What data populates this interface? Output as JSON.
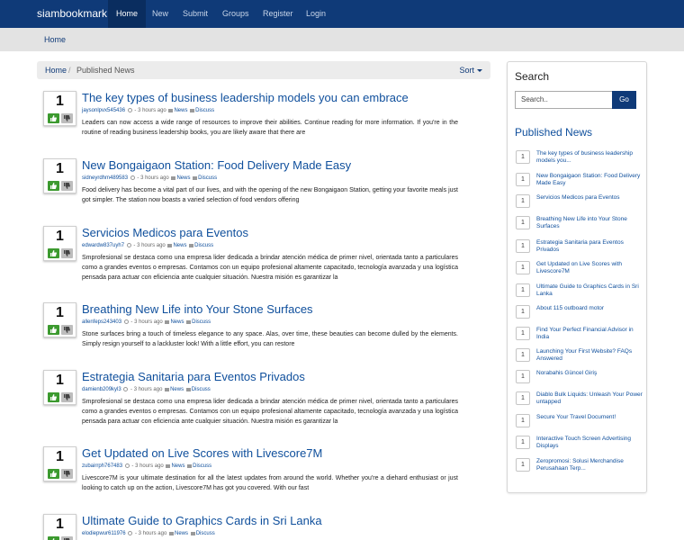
{
  "nav": {
    "brand": "siambookmark",
    "items": [
      "Home",
      "New",
      "Submit",
      "Groups",
      "Register",
      "Login"
    ]
  },
  "subbar": {
    "crumb": "Home"
  },
  "breadcrumb": {
    "home": "Home",
    "separator": "/",
    "current": "Published News",
    "sort": "Sort"
  },
  "posts": [
    {
      "votes": "1",
      "title": "The key types of business leadership models you can embrace",
      "user": "jaysonlpvx545436",
      "time": "3 hours ago",
      "category": "News",
      "discuss": "Discuss",
      "desc": "Leaders can now access a wide range of resources to improve their abilities. Continue reading for more information. If you're in the routine of reading business leadership books, you are likely aware that there are"
    },
    {
      "votes": "1",
      "title": "New Bongaigaon Station: Food Delivery Made Easy",
      "user": "sidneyrdhm489583",
      "time": "3 hours ago",
      "category": "News",
      "discuss": "Discuss",
      "desc": "Food delivery has become a vital part of our lives, and with the opening of the new Bongaigaon Station, getting your favorite meals just got simpler. The station now boasts a varied selection of food vendors offering"
    },
    {
      "votes": "1",
      "title": "Servicios Medicos para Eventos",
      "user": "edwardw837uyh7",
      "time": "3 hours ago",
      "category": "News",
      "discuss": "Discuss",
      "desc": "Smprofesional se destaca como una empresa lider dedicada a brindar atención médica de primer nivel, orientada tanto a particulares como a grandes eventos o empresas. Contamos con un equipo profesional altamente capacitado, tecnología avanzada y una logística pensada para actuar con eficiencia ante cualquier situación. Nuestra misión es garantizar la"
    },
    {
      "votes": "1",
      "title": "Breathing New Life into Your Stone Surfaces",
      "user": "allenfeps243403",
      "time": "3 hours ago",
      "category": "News",
      "discuss": "Discuss",
      "desc": "Stone surfaces bring a touch of timeless elegance to any space. Alas, over time, these beauties can become dulled by the elements. Simply resign yourself to a lackluster look! With a little effort, you can restore"
    },
    {
      "votes": "1",
      "title": "Estrategia Sanitaria para Eventos Privados",
      "user": "damienb209kyl3",
      "time": "3 hours ago",
      "category": "News",
      "discuss": "Discuss",
      "desc": "Smprofesional se destaca como una empresa lider dedicada a brindar atención médica de primer nivel, orientada tanto a particulares como a grandes eventos o empresas. Contamos con un equipo profesional altamente capacitado, tecnología avanzada y una logística pensada para actuar con eficiencia ante cualquier situación. Nuestra misión es garantizar la"
    },
    {
      "votes": "1",
      "title": "Get Updated on Live Scores with Livescore7M",
      "user": "zubairrph767483",
      "time": "3 hours ago",
      "category": "News",
      "discuss": "Discuss",
      "desc": "Livescore7M is your ultimate destination for all the latest updates from around the world. Whether you're a diehard enthusiast or just looking to catch up on the action, Livescore7M has got you covered. With our fast"
    },
    {
      "votes": "1",
      "title": "Ultimate Guide to Graphics Cards in Sri Lanka",
      "user": "elodiepwur611976",
      "time": "3 hours ago",
      "category": "News",
      "discuss": "Discuss",
      "desc": ""
    }
  ],
  "sidebar": {
    "search_title": "Search",
    "search_placeholder": "Search..",
    "go": "Go",
    "published_title": "Published News",
    "items": [
      {
        "count": "1",
        "label": "The key types of business leadership models you..."
      },
      {
        "count": "1",
        "label": "New Bongaigaon Station: Food Delivery Made Easy"
      },
      {
        "count": "1",
        "label": "Servicios Medicos para Eventos"
      },
      {
        "count": "1",
        "label": "Breathing New Life into Your Stone Surfaces"
      },
      {
        "count": "1",
        "label": "Estrategia Sanitaria para Eventos Privados"
      },
      {
        "count": "1",
        "label": "Get Updated on Live Scores with Livescore7M"
      },
      {
        "count": "1",
        "label": "Ultimate Guide to Graphics Cards in Sri Lanka"
      },
      {
        "count": "1",
        "label": "About 115 outboard motor"
      },
      {
        "count": "1",
        "label": "Find Your Perfect Financial Advisor in India"
      },
      {
        "count": "1",
        "label": "Launching Your First Website? FAQs Answered"
      },
      {
        "count": "1",
        "label": "Norabahis Güncel Giriş"
      },
      {
        "count": "1",
        "label": "Diablo Bulk Liquids: Unleash Your Power untapped"
      },
      {
        "count": "1",
        "label": "Secure Your Travel Document!"
      },
      {
        "count": "1",
        "label": "Interactive Touch Screen Advertising Displays"
      },
      {
        "count": "1",
        "label": "Zeropromosi: Solusi Merchandise Perusahaan Terp..."
      }
    ]
  }
}
